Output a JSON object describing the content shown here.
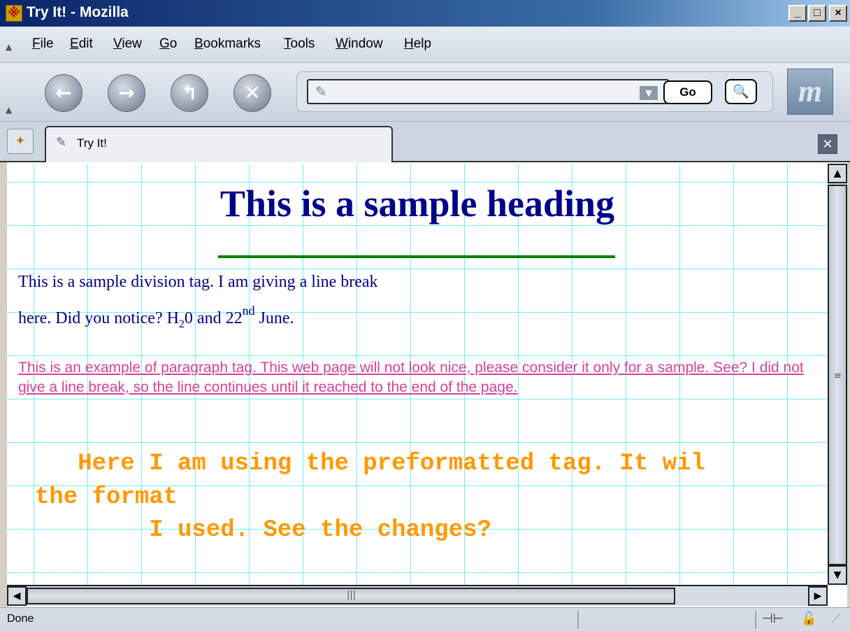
{
  "window": {
    "title": "Try It! - Mozilla",
    "min_label": "_",
    "max_label": "□",
    "close_label": "×"
  },
  "menu": [
    {
      "label": "File"
    },
    {
      "label": "Edit"
    },
    {
      "label": "View"
    },
    {
      "label": "Go"
    },
    {
      "label": "Bookmarks"
    },
    {
      "label": "Tools"
    },
    {
      "label": "Window"
    },
    {
      "label": "Help"
    }
  ],
  "toolbar": {
    "back_icon": "back-arrow-icon",
    "forward_icon": "forward-arrow-icon",
    "reload_icon": "reload-icon",
    "stop_icon": "stop-icon",
    "url_value": "",
    "go_label": "Go",
    "search_icon": "magnifier-icon",
    "logo_text": "m"
  },
  "tabs": [
    {
      "label": "Try It!"
    }
  ],
  "content": {
    "heading": "This is a sample heading",
    "hr_color": "#008000",
    "div_line1": "This is a sample division tag. I am giving a line break",
    "div_line2_prefix": "here. Did you notice? H",
    "div_line2_sub": "2",
    "div_line2_mid": "0 and 22",
    "div_line2_sup": "nd",
    "div_line2_suffix": " June.",
    "paragraph": "This is an example of paragraph tag. This web page will not look nice, please consider it only for a sample. See? I did not give a line break, so the line continues until it reached to the end of the page.",
    "pre_line1": "   Here I am using the preformatted tag. It wil",
    "pre_line2": "the format",
    "pre_line3": "        I used. See the changes?",
    "colors": {
      "heading": "#00008b",
      "division": "#00008b",
      "paragraph": "#d6409c",
      "pre": "#ff9900",
      "grid": "#00e1eb"
    }
  },
  "status": {
    "text": "Done"
  }
}
